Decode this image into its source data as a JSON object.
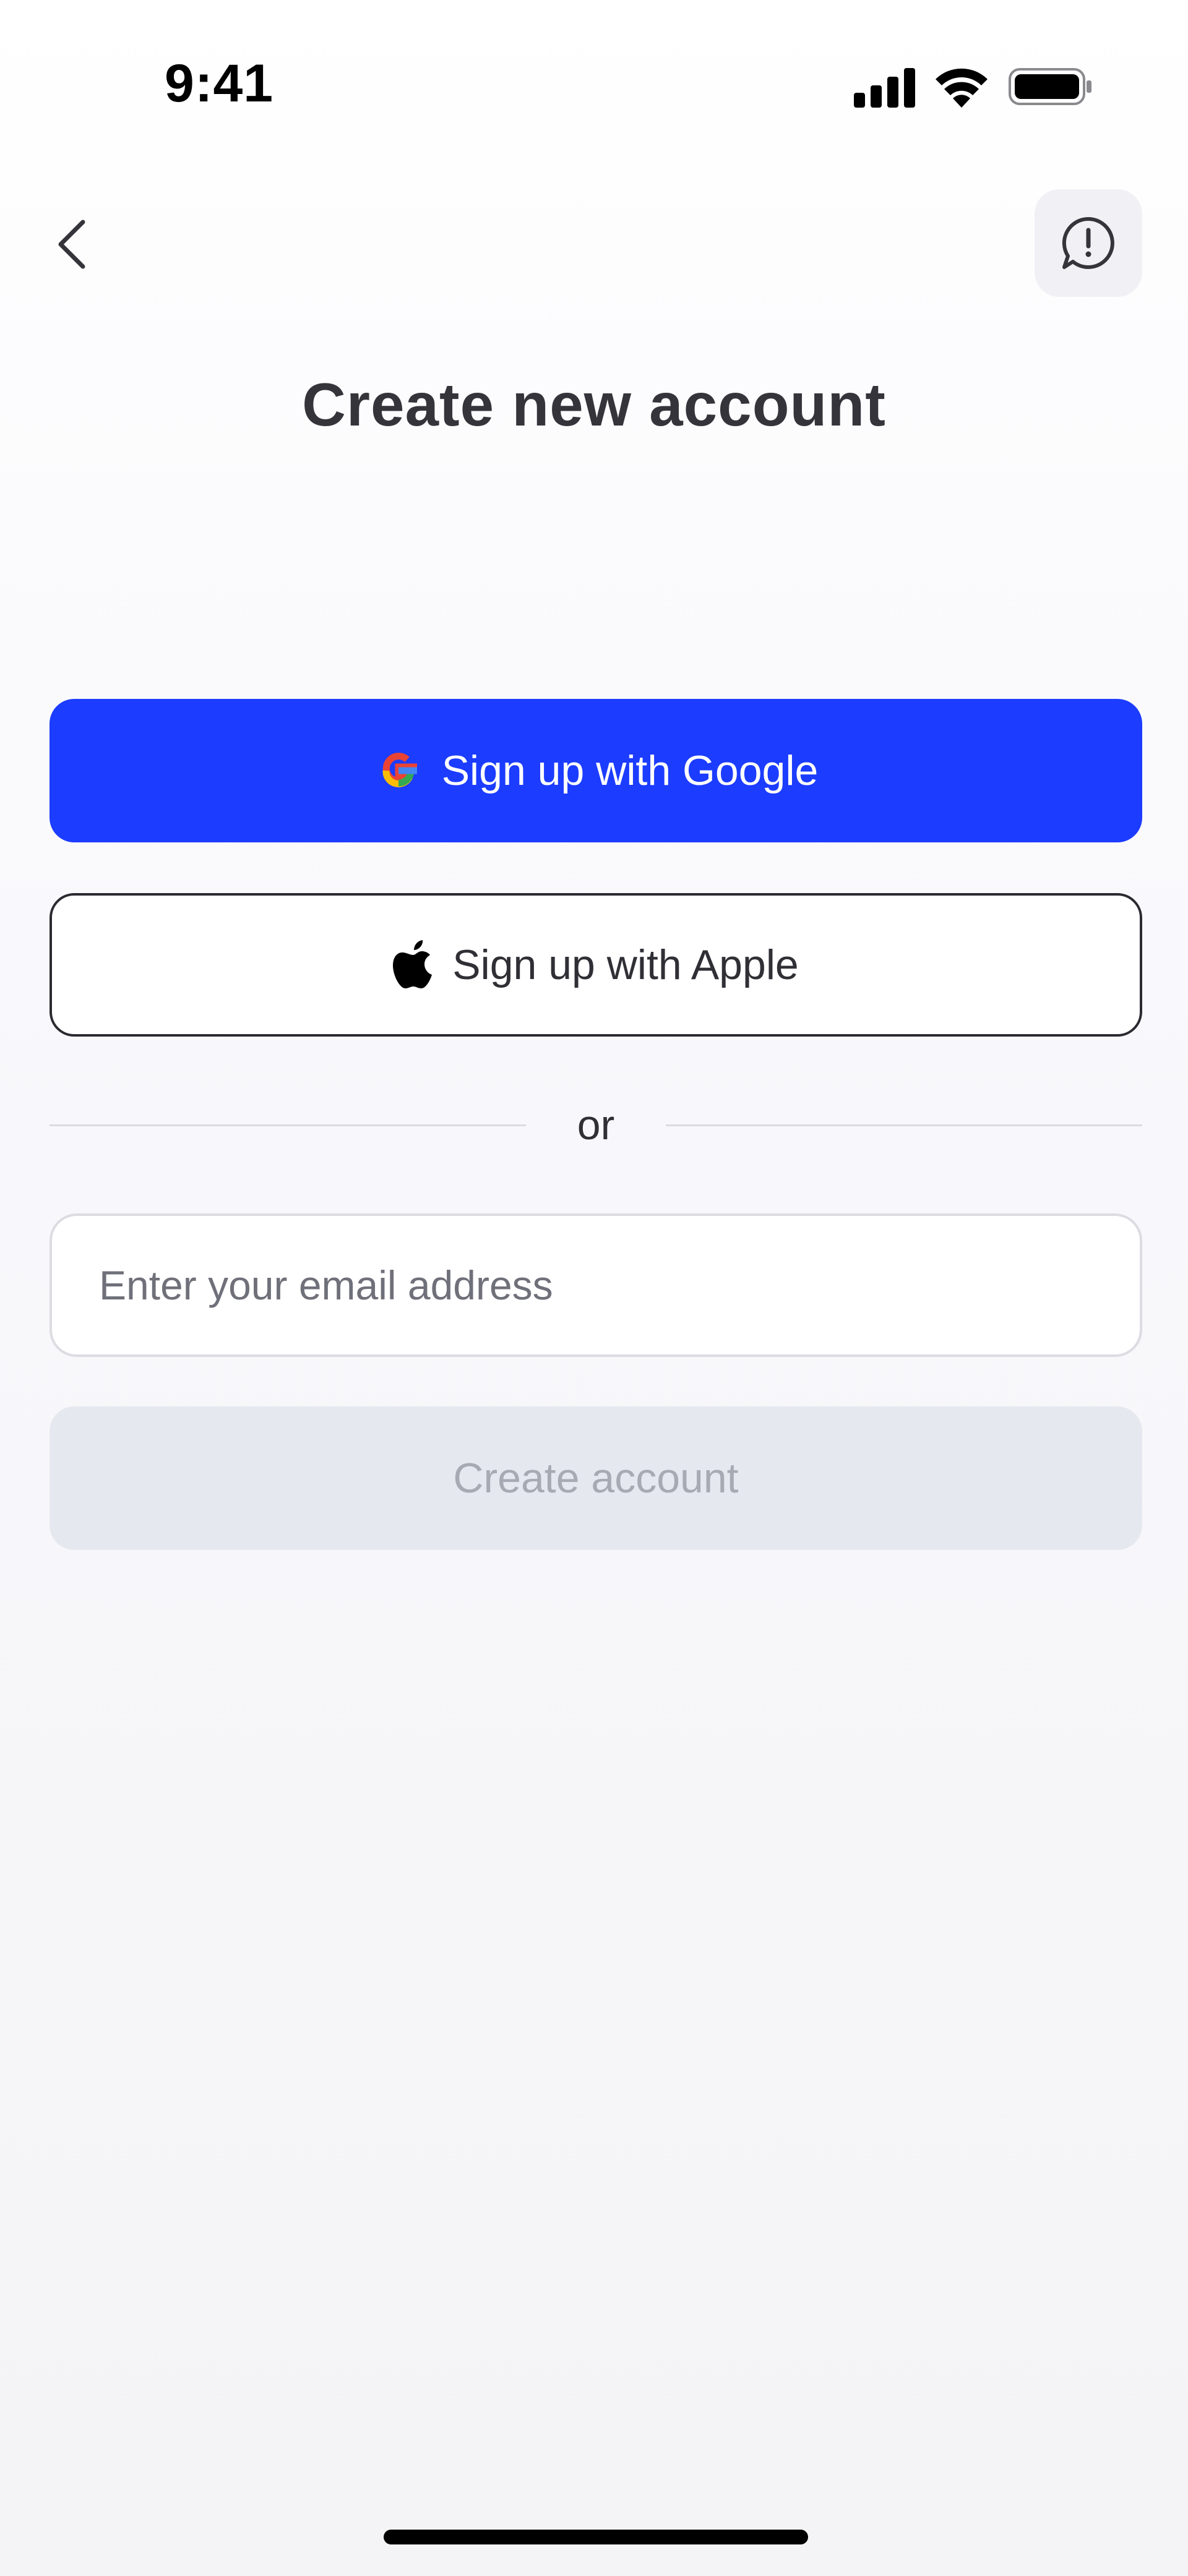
{
  "status_bar": {
    "time": "9:41",
    "icons": [
      "signal-icon",
      "wifi-icon",
      "battery-icon"
    ]
  },
  "header": {
    "back_icon": "chevron-left-icon",
    "report_icon": "exclamation-bubble-icon"
  },
  "page": {
    "title": "Create new account"
  },
  "auth": {
    "google_label": "Sign up with Google",
    "google_icon": "google-icon",
    "apple_label": "Sign up with Apple",
    "apple_icon": "apple-icon",
    "divider_text": "or"
  },
  "form": {
    "email_value": "",
    "email_placeholder": "Enter your email address",
    "submit_label": "Create account",
    "submit_enabled": false
  },
  "colors": {
    "primary": "#1c3cff",
    "disabled_bg": "#e6e8f0",
    "disabled_text": "#a8aab3",
    "title_text": "#35343b"
  }
}
